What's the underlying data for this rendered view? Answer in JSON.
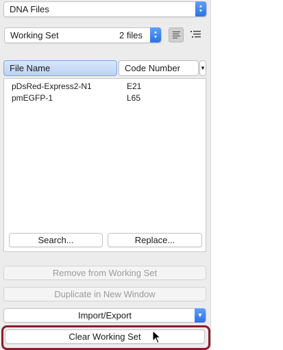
{
  "source_dropdown": {
    "label": "DNA Files"
  },
  "set_selector": {
    "label": "Working Set",
    "count": "2 files"
  },
  "icons": {
    "list_view": "list-lines-icon",
    "outline_view": "outline-list-icon",
    "pointer": "mouse-pointer-icon"
  },
  "table": {
    "columns": [
      "File Name",
      "Code Number"
    ],
    "rows": [
      {
        "name": "pDsRed-Express2-N1",
        "code": "E21"
      },
      {
        "name": "pmEGFP-1",
        "code": "L65"
      }
    ]
  },
  "buttons": {
    "search": "Search...",
    "replace": "Replace...",
    "remove": "Remove from Working Set",
    "duplicate": "Duplicate in New Window",
    "import_export": "Import/Export",
    "clear": "Clear Working Set"
  },
  "colors": {
    "accent": "#2a72e6",
    "highlight_border": "#8a1c2b"
  }
}
